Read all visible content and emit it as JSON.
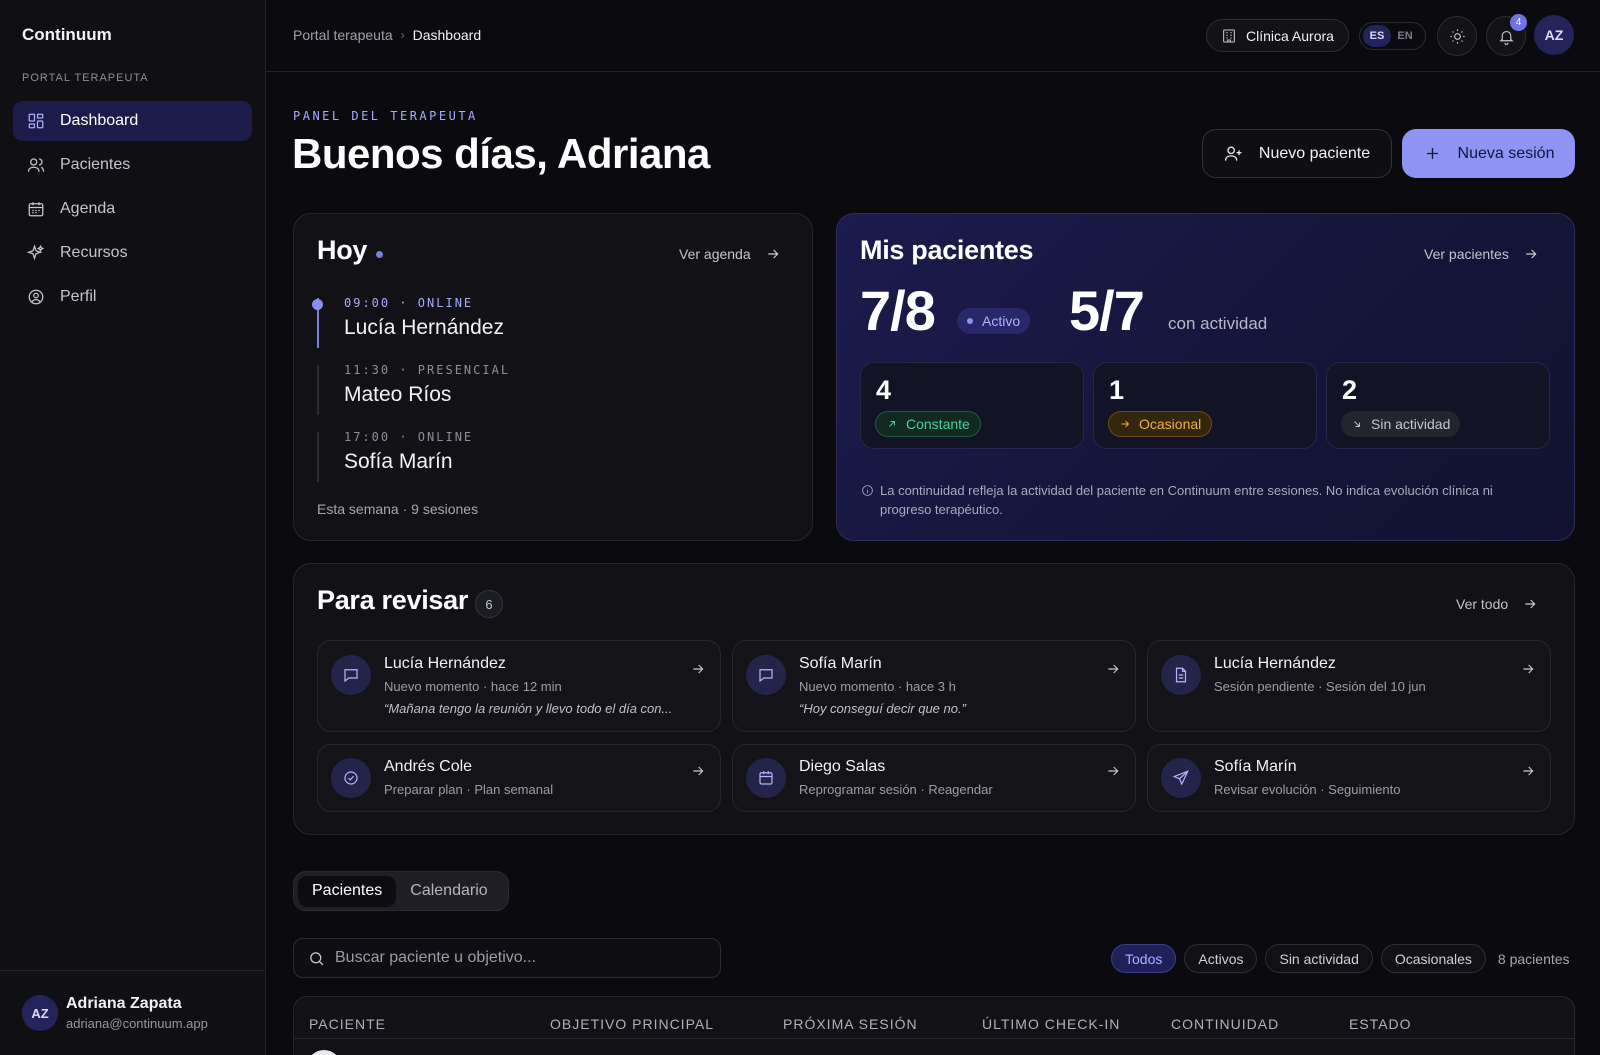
{
  "sidebar": {
    "brand": "Continuum",
    "section": "PORTAL TERAPEUTA",
    "items": [
      {
        "label": "Dashboard",
        "icon": "dashboard-icon"
      },
      {
        "label": "Pacientes",
        "icon": "users-icon"
      },
      {
        "label": "Agenda",
        "icon": "calendar-icon"
      },
      {
        "label": "Recursos",
        "icon": "sparkles-icon"
      },
      {
        "label": "Perfil",
        "icon": "user-circle-icon"
      }
    ],
    "user": {
      "initials": "AZ",
      "name": "Adriana Zapata",
      "email": "adriana@continuum.app"
    }
  },
  "topbar": {
    "breadcrumb": [
      "Portal terapeuta",
      "Dashboard"
    ],
    "clinic": "Clínica Aurora",
    "lang": [
      "ES",
      "EN"
    ],
    "notifications": "4",
    "avatar": "AZ"
  },
  "header": {
    "eyebrow": "PANEL DEL TERAPEUTA",
    "greeting": "Buenos días, Adriana",
    "new_patient": "Nuevo paciente",
    "new_session": "Nueva sesión"
  },
  "today": {
    "title": "Hoy",
    "link": "Ver agenda",
    "sessions": [
      {
        "time": "09:00 · ONLINE",
        "name": "Lucía Hernández"
      },
      {
        "time": "11:30 · PRESENCIAL",
        "name": "Mateo Ríos"
      },
      {
        "time": "17:00 · ONLINE",
        "name": "Sofía Marín"
      }
    ],
    "week": "Esta semana · 9 sesiones"
  },
  "patients": {
    "title": "Mis pacientes",
    "link": "Ver pacientes",
    "active_count": "7/8",
    "active_label": "Activo",
    "activity_count": "5/7",
    "activity_label": "con actividad",
    "stats": [
      {
        "value": "4",
        "label": "Constante"
      },
      {
        "value": "1",
        "label": "Ocasional"
      },
      {
        "value": "2",
        "label": "Sin actividad"
      }
    ],
    "note": "La continuidad refleja la actividad del paciente en Continuum entre sesiones. No indica evolución clínica ni progreso terapéutico."
  },
  "review": {
    "title": "Para revisar",
    "count": "6",
    "link": "Ver todo",
    "items": [
      {
        "name": "Lucía Hernández",
        "sub": "Nuevo momento · hace 12 min",
        "quote": "“Mañana tengo la reunión y llevo todo el día con...",
        "icon": "message-icon"
      },
      {
        "name": "Sofía Marín",
        "sub": "Nuevo momento · hace 3 h",
        "quote": "“Hoy conseguí decir que no.”",
        "icon": "message-icon"
      },
      {
        "name": "Lucía Hernández",
        "sub": "Sesión pendiente · Sesión del 10 jun",
        "quote": "",
        "icon": "document-icon"
      },
      {
        "name": "Andrés Cole",
        "sub": "Preparar plan · Plan semanal",
        "quote": "",
        "icon": "check-circle-icon"
      },
      {
        "name": "Diego Salas",
        "sub": "Reprogramar sesión · Reagendar",
        "quote": "",
        "icon": "calendar-icon"
      },
      {
        "name": "Sofía Marín",
        "sub": "Revisar evolución · Seguimiento",
        "quote": "",
        "icon": "send-icon"
      }
    ]
  },
  "tabs": [
    "Pacientes",
    "Calendario"
  ],
  "search": {
    "placeholder": "Buscar paciente u objetivo..."
  },
  "filters": [
    "Todos",
    "Activos",
    "Sin actividad",
    "Ocasionales"
  ],
  "patient_count": "8 pacientes",
  "table": {
    "headers": [
      "PACIENTE",
      "OBJETIVO PRINCIPAL",
      "PRÓXIMA SESIÓN",
      "ÚLTIMO CHECK-IN",
      "CONTINUIDAD",
      "ESTADO"
    ]
  },
  "colors": {
    "accent": "#8f93f3",
    "constante": "#45d39a",
    "ocasional": "#f2b03c"
  }
}
